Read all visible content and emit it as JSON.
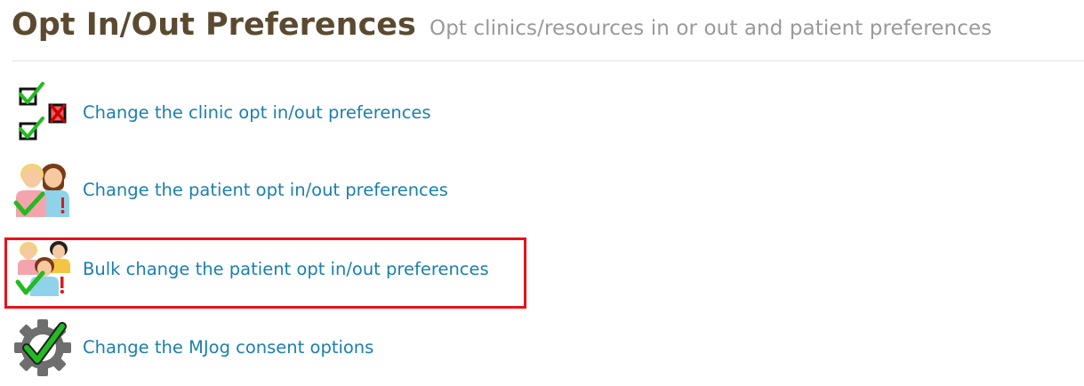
{
  "header": {
    "title": "Opt In/Out Preferences",
    "subtitle": "Opt clinics/resources in or out and patient preferences"
  },
  "menu": {
    "items": [
      {
        "label": "Change the clinic opt in/out preferences",
        "icon": "clinic-checklist-icon"
      },
      {
        "label": "Change the patient opt in/out preferences",
        "icon": "patients-icon"
      },
      {
        "label": "Bulk change the patient opt in/out preferences",
        "icon": "patients-group-icon",
        "highlighted": true
      },
      {
        "label": "Change the MJog consent options",
        "icon": "gear-check-icon"
      }
    ]
  },
  "colors": {
    "title": "#5b4a30",
    "subtitle": "#999999",
    "link": "#1a7fae",
    "highlight_border": "#e8111b",
    "check_green": "#22bb22",
    "cross_red": "#e01818"
  }
}
